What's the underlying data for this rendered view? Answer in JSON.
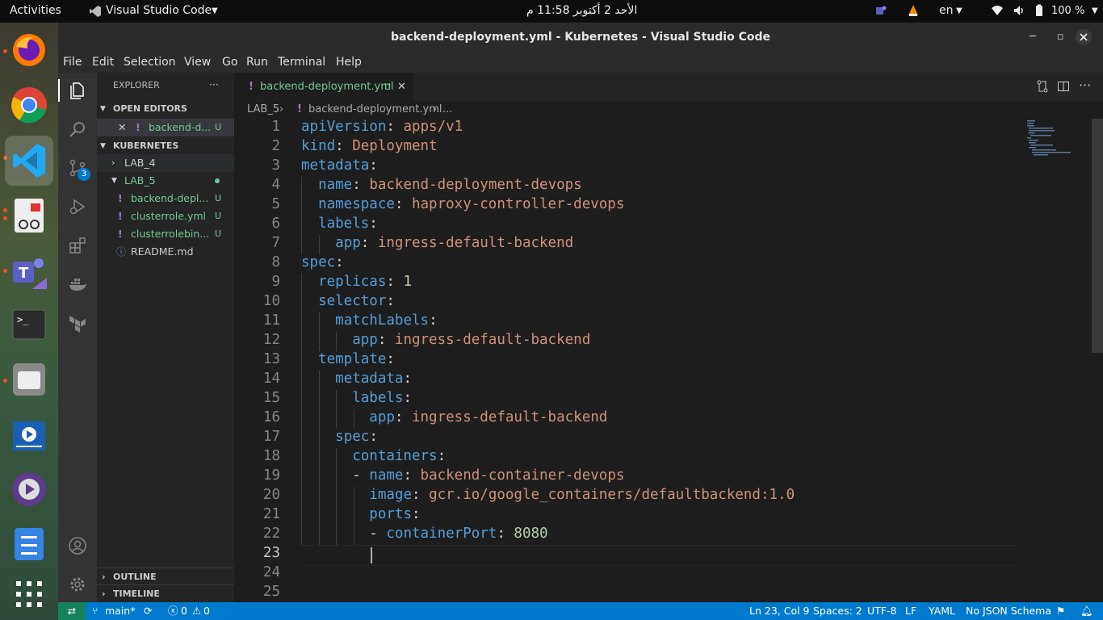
{
  "topbar": {
    "activities": "Activities",
    "app_name": "Visual Studio Code",
    "clock": "الأحد 2 أكتوبر 11:58 م",
    "lang": "en",
    "battery": "100 %"
  },
  "window": {
    "title": "backend-deployment.yml - Kubernetes - Visual Studio Code"
  },
  "menu": [
    "File",
    "Edit",
    "Selection",
    "View",
    "Go",
    "Run",
    "Terminal",
    "Help"
  ],
  "activity": {
    "scm_badge": "3"
  },
  "explorer": {
    "title": "EXPLORER",
    "more": "···",
    "open_editors": "OPEN EDITORS",
    "open_file": "backend-d...",
    "open_file_status": "U",
    "workspace": "KUBERNETES",
    "folders": [
      {
        "name": "LAB_4"
      },
      {
        "name": "LAB_5"
      }
    ],
    "files": [
      {
        "name": "backend-depl...",
        "status": "U"
      },
      {
        "name": "clusterrole.yml",
        "status": "U"
      },
      {
        "name": "clusterrolebin...",
        "status": "U"
      },
      {
        "name": "README.md",
        "status": ""
      }
    ],
    "outline": "OUTLINE",
    "timeline": "TIMELINE"
  },
  "tab": {
    "label": "backend-deployment.yml",
    "status": "U"
  },
  "breadcrumb": {
    "folder": "LAB_5",
    "file": "backend-deployment.yml",
    "more": "..."
  },
  "code": [
    {
      "n": "1",
      "i": 0,
      "k": "apiVersion",
      "v": "apps/v1"
    },
    {
      "n": "2",
      "i": 0,
      "k": "kind",
      "v": "Deployment"
    },
    {
      "n": "3",
      "i": 0,
      "k": "metadata",
      "v": ""
    },
    {
      "n": "4",
      "i": 1,
      "k": "name",
      "v": "backend-deployment-devops"
    },
    {
      "n": "5",
      "i": 1,
      "k": "namespace",
      "v": "haproxy-controller-devops"
    },
    {
      "n": "6",
      "i": 1,
      "k": "labels",
      "v": ""
    },
    {
      "n": "7",
      "i": 2,
      "k": "app",
      "v": "ingress-default-backend"
    },
    {
      "n": "8",
      "i": 0,
      "k": "spec",
      "v": ""
    },
    {
      "n": "9",
      "i": 1,
      "k": "replicas",
      "v": "1",
      "num": true
    },
    {
      "n": "10",
      "i": 1,
      "k": "selector",
      "v": ""
    },
    {
      "n": "11",
      "i": 2,
      "k": "matchLabels",
      "v": ""
    },
    {
      "n": "12",
      "i": 3,
      "k": "app",
      "v": "ingress-default-backend"
    },
    {
      "n": "13",
      "i": 1,
      "k": "template",
      "v": ""
    },
    {
      "n": "14",
      "i": 2,
      "k": "metadata",
      "v": ""
    },
    {
      "n": "15",
      "i": 3,
      "k": "labels",
      "v": ""
    },
    {
      "n": "16",
      "i": 4,
      "k": "app",
      "v": "ingress-default-backend"
    },
    {
      "n": "17",
      "i": 2,
      "k": "spec",
      "v": ""
    },
    {
      "n": "18",
      "i": 3,
      "k": "containers",
      "v": ""
    },
    {
      "n": "19",
      "i": 3,
      "dash": true,
      "k": "name",
      "v": "backend-container-devops"
    },
    {
      "n": "20",
      "i": 4,
      "k": "image",
      "v": "gcr.io/google_containers/defaultbackend:1.0"
    },
    {
      "n": "21",
      "i": 4,
      "k": "ports",
      "v": ""
    },
    {
      "n": "22",
      "i": 4,
      "dash": true,
      "k": "containerPort",
      "v": "8080",
      "num": true
    },
    {
      "n": "23",
      "i": 0,
      "k": "",
      "v": ""
    },
    {
      "n": "24",
      "i": 0,
      "k": "",
      "v": ""
    },
    {
      "n": "25",
      "i": 0,
      "k": "",
      "v": ""
    }
  ],
  "status": {
    "branch": "main*",
    "errors": "0",
    "warnings": "0",
    "position": "Ln 23, Col 9",
    "spaces": "Spaces: 2",
    "encoding": "UTF-8",
    "eol": "LF",
    "language": "YAML",
    "schema": "No JSON Schema"
  },
  "colors": {
    "accent": "#007acc",
    "key": "#569cd6",
    "string": "#ce9178",
    "number": "#b5cea8",
    "untracked": "#73c991",
    "yaml_icon": "#a074c4"
  }
}
